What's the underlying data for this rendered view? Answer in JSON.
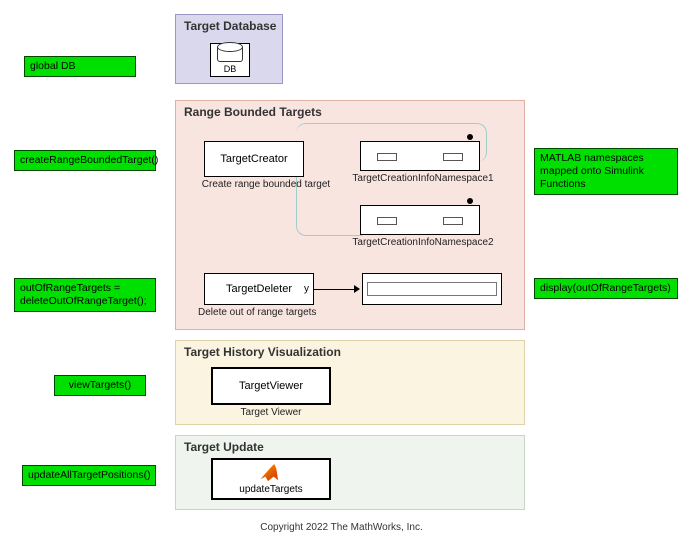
{
  "labels": {
    "global_db": "global DB",
    "create_rbt": "createRangeBoundedTarget()",
    "delete_oar": "outOfRangeTargets = deleteOutOfRangeTarget();",
    "view_targets": "viewTargets()",
    "update_all": "updateAllTargetPositions()",
    "matlab_ns": "MATLAB namespaces mapped onto Simulink Functions",
    "display_oar": "display(outOfRangeTargets)"
  },
  "panels": {
    "db": {
      "title": "Target Database"
    },
    "rbt": {
      "title": "Range Bounded Targets"
    },
    "hist": {
      "title": "Target History Visualization"
    },
    "upd": {
      "title": "Target Update"
    }
  },
  "blocks": {
    "db": {
      "text": "DB"
    },
    "creator": {
      "name": "TargetCreator",
      "caption": "Create range bounded target"
    },
    "ns1": {
      "caption": "TargetCreationInfoNamespace1"
    },
    "ns2": {
      "caption": "TargetCreationInfoNamespace2"
    },
    "deleter": {
      "name": "TargetDeleter",
      "port": "y",
      "caption": "Delete out of range targets"
    },
    "sink": {
      "name": ""
    },
    "viewer": {
      "name": "TargetViewer",
      "caption": "Target Viewer"
    },
    "updater": {
      "name": "updateTargets"
    }
  },
  "footer": "Copyright 2022 The MathWorks, Inc."
}
